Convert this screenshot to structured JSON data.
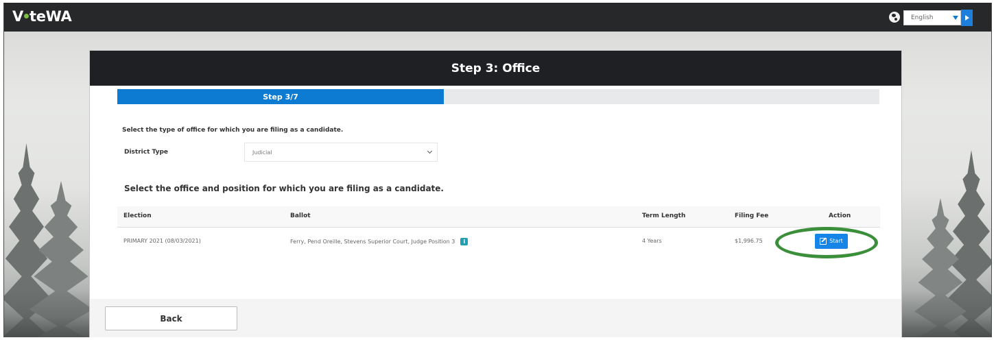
{
  "app": {
    "brand": {
      "prefix": "V",
      "suffix": "teWA"
    },
    "language": {
      "selected": "English"
    }
  },
  "page": {
    "title": "Step 3: Office",
    "progress": {
      "label": "Step 3/7",
      "current": 3,
      "total": 7,
      "fraction": 0.4286
    },
    "office_type_heading": "Select the type of office for which you are filing as a candidate.",
    "district_type": {
      "label": "District Type",
      "value": "Judicial"
    },
    "position_heading": "Select the office and position for which you are filing as a candidate."
  },
  "table": {
    "headers": [
      "Election",
      "Ballot",
      "Term Length",
      "Filing Fee",
      "Action"
    ],
    "rows": [
      {
        "election": "PRIMARY 2021 (08/03/2021)",
        "ballot": "Ferry, Pend Oreille, Stevens Superior Court, Judge Position 3",
        "term_length": "4 Years",
        "filing_fee": "$1,996.75",
        "action": {
          "label": "Start",
          "icon": "edit-icon"
        }
      }
    ]
  },
  "footer": {
    "back_label": "Back"
  },
  "icons": {
    "language": "globe-icon",
    "language_submit": "chevron-right-icon",
    "dropdown": "chevron-down-icon",
    "ballot_info": "info-icon",
    "start": "edit-icon"
  },
  "colors": {
    "topbar": "#27282a",
    "panel_header": "#1f2023",
    "progress": "#0d7bd1",
    "start_button": "#1784e8",
    "info_icon": "#21a0b1",
    "highlight": "#3b8f3b",
    "brand_dot": "#7ac143"
  }
}
